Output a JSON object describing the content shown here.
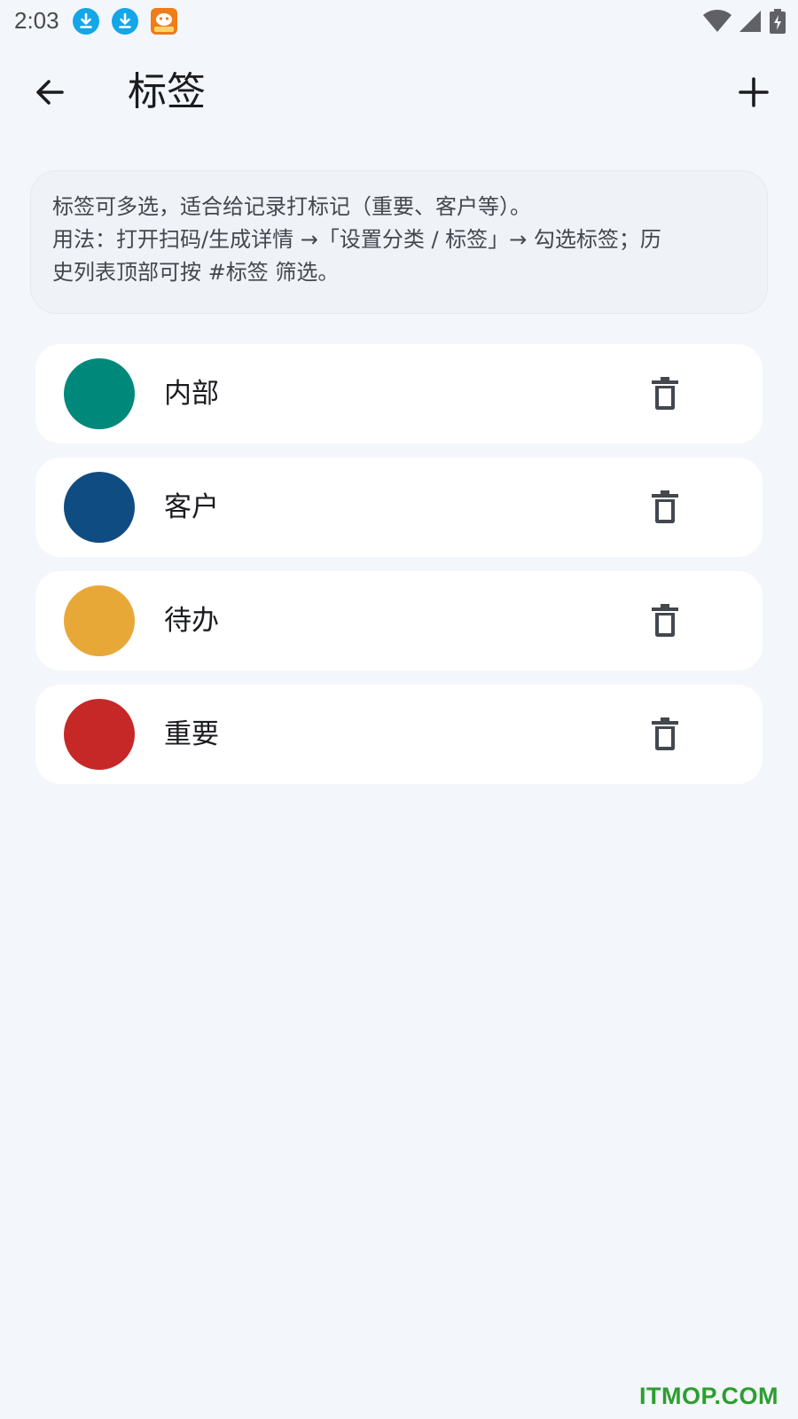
{
  "status_bar": {
    "time": "2:03",
    "icons": [
      "download-icon",
      "download-icon",
      "app-notification-icon",
      "wifi-icon",
      "signal-icon",
      "battery-charging-icon"
    ]
  },
  "app_bar": {
    "title": "标签",
    "back_icon": "arrow-back-icon",
    "add_icon": "plus-icon"
  },
  "info": {
    "text": "标签可多选，适合给记录打标记（重要、客户等）。\n用法：打开扫码/生成详情 →「设置分类 / 标签」→ 勾选标签；历\n史列表顶部可按 #标签 筛选。"
  },
  "tags": [
    {
      "name": "内部",
      "color": "#00897b"
    },
    {
      "name": "客户",
      "color": "#0f4c81"
    },
    {
      "name": "待办",
      "color": "#e8a838"
    },
    {
      "name": "重要",
      "color": "#c62828"
    }
  ],
  "colors": {
    "background": "#f3f6fb",
    "card": "#ffffff",
    "info_card": "#eff3f8",
    "icon": "#43474e"
  },
  "watermark": "ITMOP.COM"
}
